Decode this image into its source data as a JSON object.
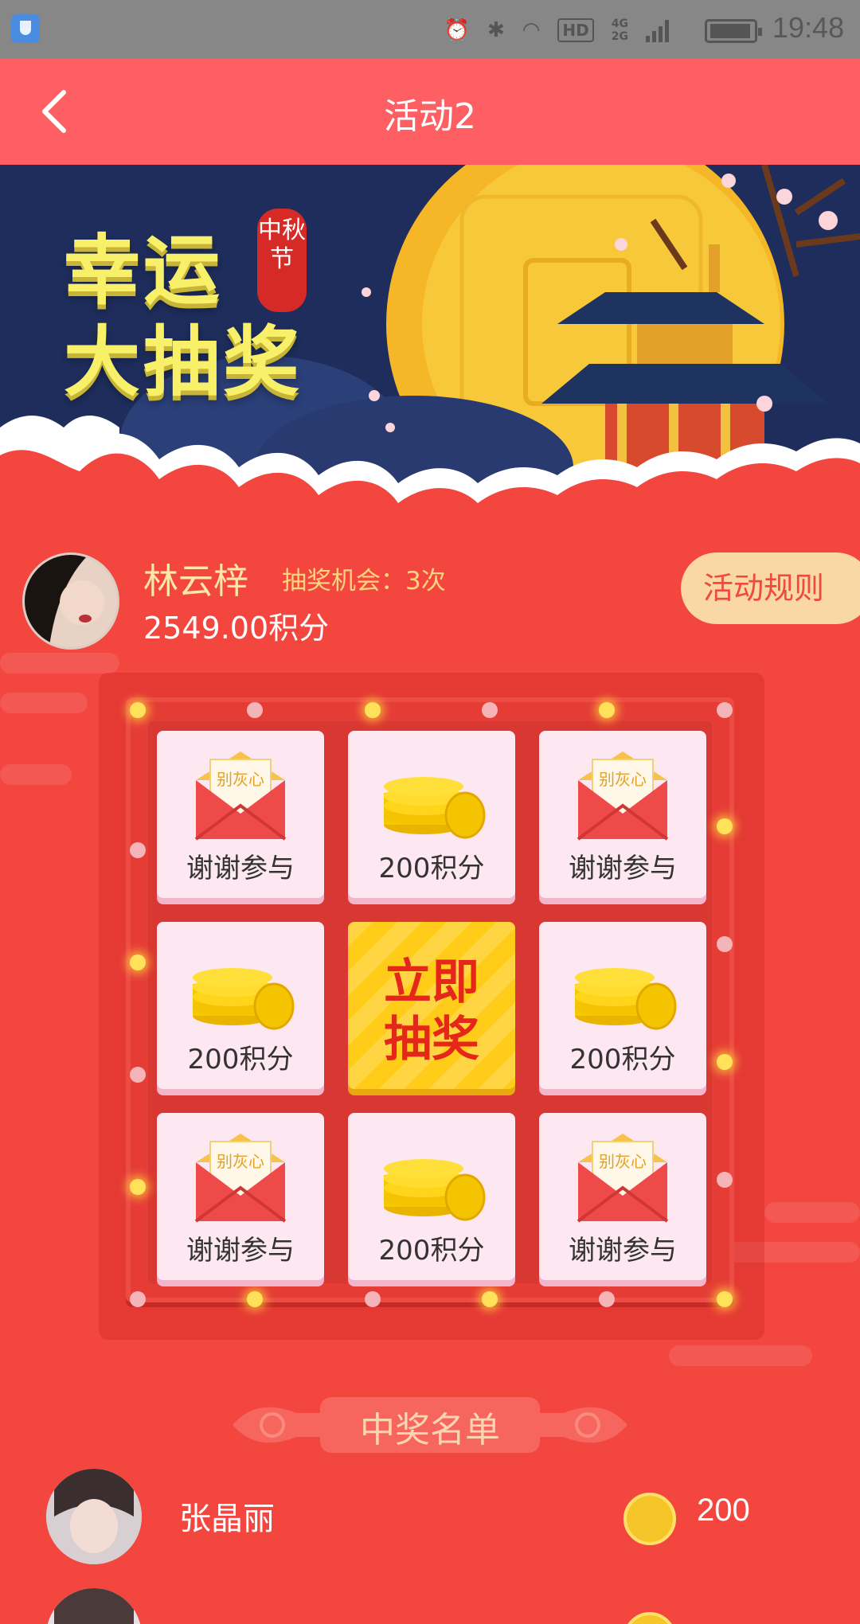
{
  "status_bar": {
    "time": "19:48",
    "hd_label": "HD",
    "network_labels": [
      "4G",
      "2G"
    ],
    "icons": [
      "shield-icon",
      "alarm-icon",
      "bluetooth-icon",
      "wifi-icon",
      "signal-icon",
      "battery-icon"
    ]
  },
  "header": {
    "title": "活动2",
    "back_icon": "chevron-left-icon"
  },
  "banner": {
    "line1": "幸运",
    "line2": "大抽奖",
    "seal_text": "中秋节"
  },
  "user": {
    "name": "林云梓",
    "chances": "抽奖机会：3次",
    "points": "2549.00积分",
    "rules_button": "活动规则"
  },
  "grid": {
    "cells": [
      {
        "label": "谢谢参与",
        "icon": "envelope-icon",
        "card_text": "别灰心"
      },
      {
        "label": "200积分",
        "icon": "coins-icon"
      },
      {
        "label": "谢谢参与",
        "icon": "envelope-icon",
        "card_text": "别灰心"
      },
      {
        "label": "200积分",
        "icon": "coins-icon"
      },
      {
        "label": "立即\n抽奖",
        "icon": "draw-button",
        "line1": "立即",
        "line2": "抽奖"
      },
      {
        "label": "200积分",
        "icon": "coins-icon"
      },
      {
        "label": "谢谢参与",
        "icon": "envelope-icon",
        "card_text": "别灰心"
      },
      {
        "label": "200积分",
        "icon": "coins-icon"
      },
      {
        "label": "谢谢参与",
        "icon": "envelope-icon",
        "card_text": "别灰心"
      }
    ]
  },
  "winners": {
    "title": "中奖名单",
    "rows": [
      {
        "name": "张晶丽",
        "amount": "200",
        "icon": "coin-icon"
      },
      {
        "name": "",
        "amount": "",
        "icon": "coin-icon"
      }
    ]
  },
  "colors": {
    "header": "#fd5f63",
    "background": "#f2463f",
    "accent_gold": "#ffcc1a",
    "rules_button": "#fad8a5"
  }
}
